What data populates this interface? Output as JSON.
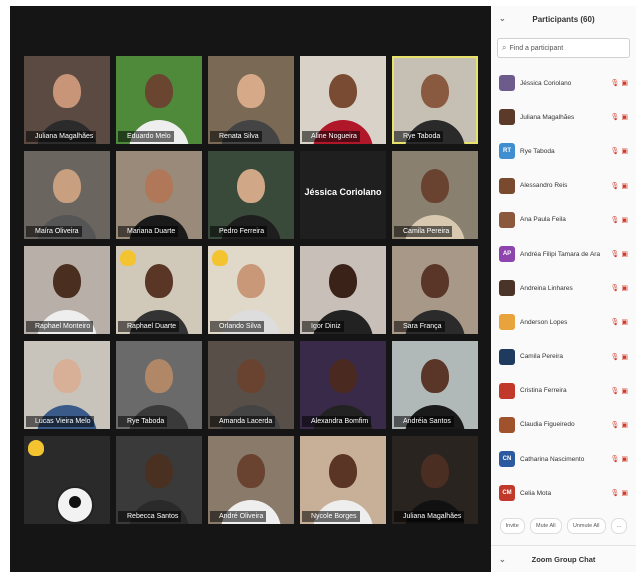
{
  "participants_panel": {
    "title": "Participants (60)",
    "search_placeholder": "Find a participant",
    "participants": [
      {
        "initials": "",
        "name": "Jéssica Coriolano",
        "color": "#6d5b8c"
      },
      {
        "initials": "",
        "name": "Juliana Magalhães",
        "color": "#5b3a29"
      },
      {
        "initials": "RT",
        "name": "Rye Taboda",
        "color": "#3e8ed0"
      },
      {
        "initials": "",
        "name": "Alessandro Reis",
        "color": "#7a4a2e"
      },
      {
        "initials": "",
        "name": "Ana Paula Feila",
        "color": "#8b5a3c"
      },
      {
        "initials": "AP",
        "name": "Andréa Filipi Tamara de Araújo",
        "color": "#8e44ad"
      },
      {
        "initials": "",
        "name": "Andreina Linhares",
        "color": "#4a3428"
      },
      {
        "initials": "",
        "name": "Anderson Lopes",
        "color": "#e8a33d"
      },
      {
        "initials": "",
        "name": "Camila Pereira",
        "color": "#1f3a5f"
      },
      {
        "initials": "",
        "name": "Cristina Ferreira",
        "color": "#c0392b"
      },
      {
        "initials": "",
        "name": "Claudia Figueiredo",
        "color": "#a0522d"
      },
      {
        "initials": "CN",
        "name": "Catharina Nascimento",
        "color": "#2c5aa0"
      },
      {
        "initials": "CM",
        "name": "Celia Mota",
        "color": "#c0392b"
      }
    ],
    "reactions": [
      "Invite",
      "Mute All",
      "Unmute All",
      "..."
    ],
    "chat_title": "Zoom Group Chat"
  },
  "video_grid": {
    "tiles": [
      {
        "name": "Juliana Magalhães",
        "bg": "#5a4a42",
        "skin": "#c89578",
        "shirt": "#2b2b2b"
      },
      {
        "name": "Eduardo Melo",
        "bg": "#4f8a3a",
        "skin": "#6a4530",
        "shirt": "#eeeeee"
      },
      {
        "name": "Renata Silva",
        "bg": "#7a6a55",
        "skin": "#d6a988",
        "shirt": "#444444"
      },
      {
        "name": "Aline Nogueira",
        "bg": "#d8d2c8",
        "skin": "#7a4b33",
        "shirt": "#b0182a"
      },
      {
        "name": "Rye Taboda",
        "bg": "#c6c0b4",
        "skin": "#8a5a40",
        "shirt": "#2a2a2a",
        "active": true
      },
      {
        "name": "Maíra Oliveira",
        "bg": "#6b6560",
        "skin": "#c8a080",
        "shirt": "#555555"
      },
      {
        "name": "Mariana Duarte",
        "bg": "#9a8a7a",
        "skin": "#b07858",
        "shirt": "#1a1a1a"
      },
      {
        "name": "Pedro Ferreira",
        "bg": "#3a4a3a",
        "skin": "#d0a888",
        "shirt": "#1e1e1e"
      },
      {
        "name": "Jéssica Coriolano",
        "textonly": true
      },
      {
        "name": "Camila Pereira",
        "bg": "#8a8070",
        "skin": "#6a4230",
        "shirt": "#d8c8b0"
      },
      {
        "name": "Raphael Monteiro",
        "bg": "#b8b0a8",
        "skin": "#4a2e20",
        "shirt": "#eeeeee"
      },
      {
        "name": "Raphael Duarte",
        "bg": "#d0c8b8",
        "skin": "#5a3626",
        "shirt": "#333333",
        "hand": true
      },
      {
        "name": "Orlando Silva",
        "bg": "#e0d8c8",
        "skin": "#c89878",
        "shirt": "#dddddd",
        "hand": true
      },
      {
        "name": "Igor Diniz",
        "bg": "#c8c0b8",
        "skin": "#3a2218",
        "shirt": "#222222"
      },
      {
        "name": "Sara França",
        "bg": "#a89888",
        "skin": "#5a3628",
        "shirt": "#2b2b2b"
      },
      {
        "name": "Lucas Vieira Melo",
        "bg": "#c8c4bc",
        "skin": "#d8b098",
        "shirt": "#3a5a8a"
      },
      {
        "name": "Rye Taboda",
        "bg": "#6a6a6a",
        "skin": "#b08868",
        "shirt": "#3a3a3a"
      },
      {
        "name": "Amanda Lacerda",
        "bg": "#585048",
        "skin": "#6a4230",
        "shirt": "#444444"
      },
      {
        "name": "Alexandra Bomfim",
        "bg": "#3a2a4a",
        "skin": "#4a2a20",
        "shirt": "#222222"
      },
      {
        "name": "Andréia Santos",
        "bg": "#b0b8b8",
        "skin": "#5a3628",
        "shirt": "#1a1a1a"
      },
      {
        "name": "",
        "bg": "#2a2a2a",
        "skin": "#2a2a2a",
        "shirt": "#2a2a2a",
        "hand": true,
        "avatar": true
      },
      {
        "name": "Rebecca Santos",
        "bg": "#3a3a3a",
        "skin": "#4a3020",
        "shirt": "#2a2a2a"
      },
      {
        "name": "André Oliveira",
        "bg": "#8a7a6a",
        "skin": "#6a4230",
        "shirt": "#eeeeee"
      },
      {
        "name": "Nycole Borges",
        "bg": "#c8b098",
        "skin": "#5a3424",
        "shirt": "#eeeeee"
      },
      {
        "name": "Juliana Magalhães",
        "bg": "#2a2420",
        "skin": "#4a2e22",
        "shirt": "#111111"
      }
    ]
  }
}
